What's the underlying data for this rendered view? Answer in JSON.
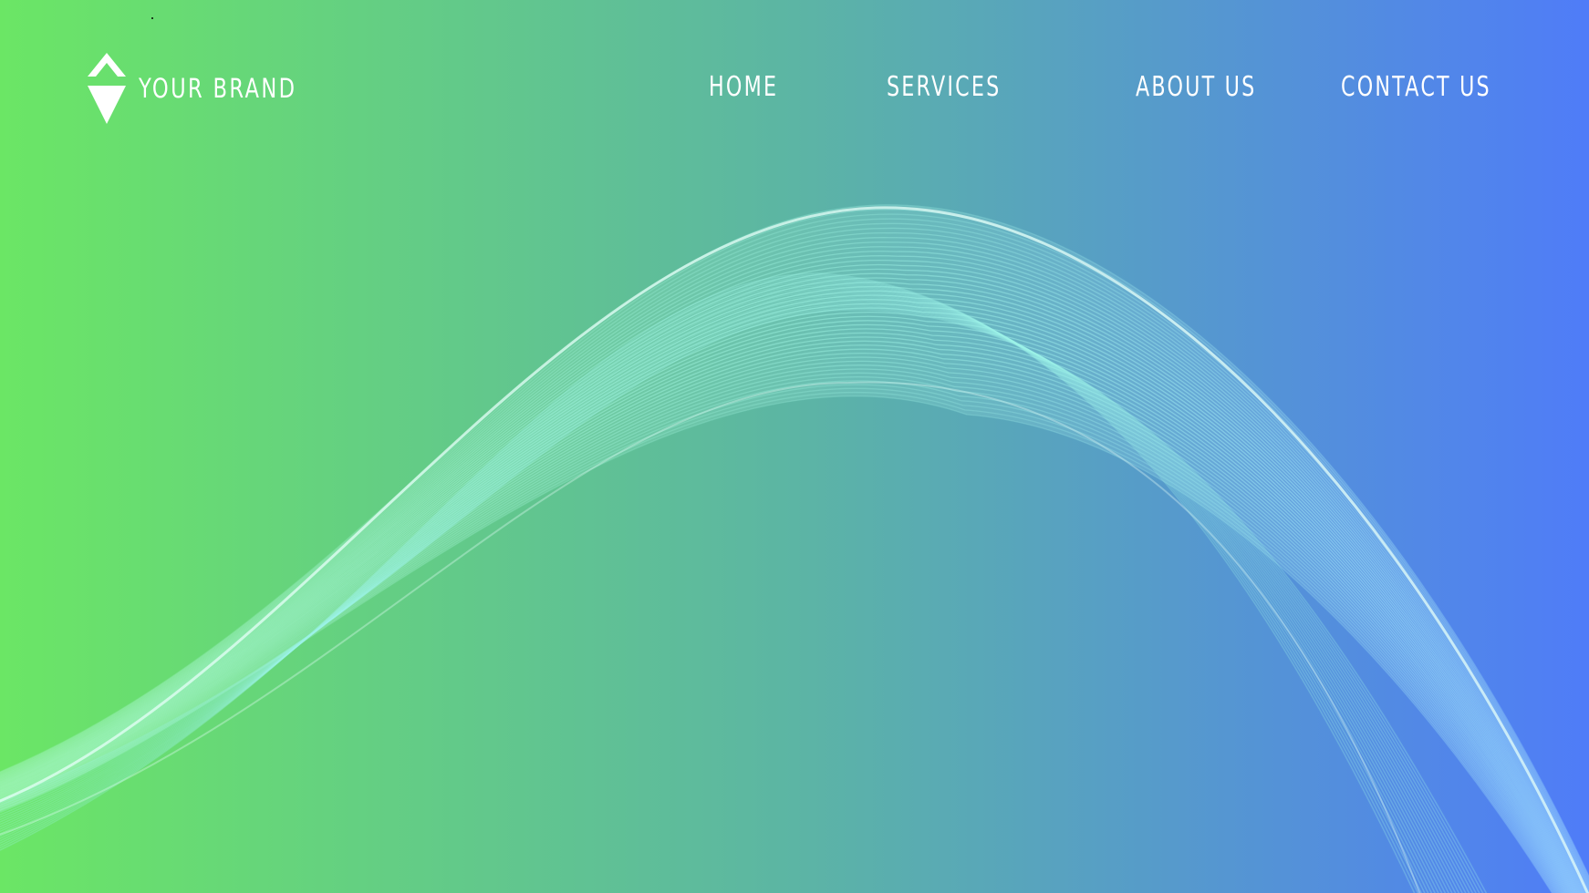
{
  "brand": {
    "name": "YOUR BRAND",
    "logo_icon": "diamond-logo-icon"
  },
  "nav": {
    "items": [
      {
        "label": "HOME"
      },
      {
        "label": "SERVICES"
      },
      {
        "label": "ABOUT US"
      },
      {
        "label": "CONTACT US"
      }
    ]
  },
  "colors": {
    "gradient_left": "#6be665",
    "gradient_mid": "#5cb5a4",
    "gradient_right": "#4f7cf8",
    "wave_light": "#8ef5e0",
    "text": "#ffffff"
  }
}
